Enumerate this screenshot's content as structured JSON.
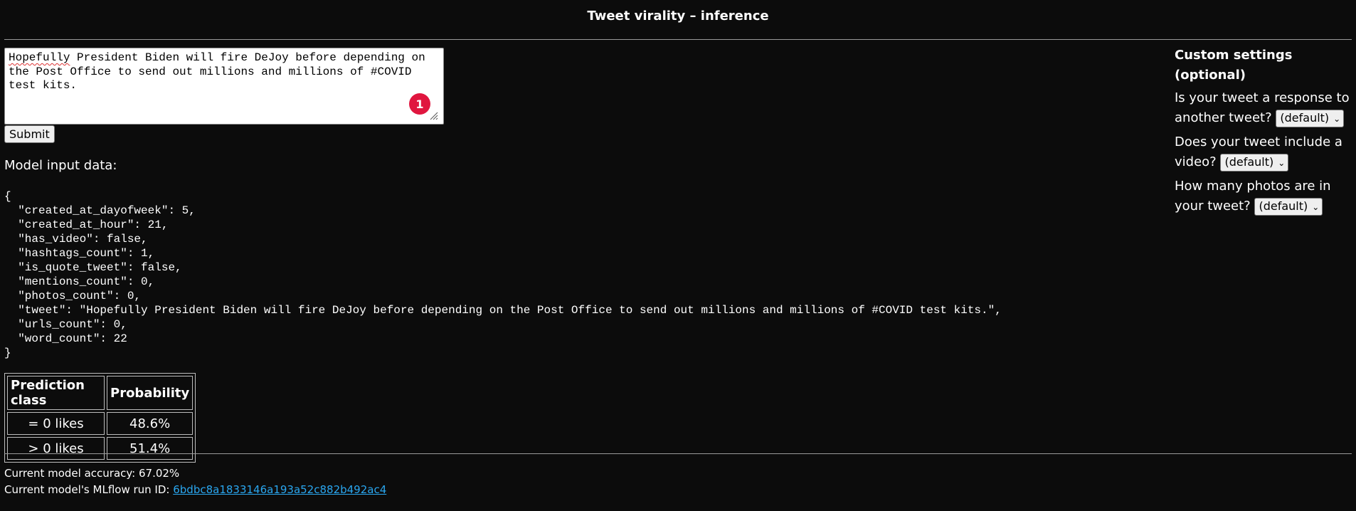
{
  "app": {
    "title": "Tweet virality – inference"
  },
  "tweet_input": {
    "value_part1": "Hopefully",
    "value_part2": " President Biden will fire DeJoy before depending on\nthe Post Office to send out millions and millions of #COVID\ntest kits.",
    "badge": "1"
  },
  "actions": {
    "submit_label": "Submit"
  },
  "model_input": {
    "label": "Model input data:",
    "json_text": "{\n  \"created_at_dayofweek\": 5,\n  \"created_at_hour\": 21,\n  \"has_video\": false,\n  \"hashtags_count\": 1,\n  \"is_quote_tweet\": false,\n  \"mentions_count\": 0,\n  \"photos_count\": 0,\n  \"tweet\": \"Hopefully President Biden will fire DeJoy before depending on the Post Office to send out millions and millions of #COVID test kits.\",\n  \"urls_count\": 0,\n  \"word_count\": 22\n}"
  },
  "prediction_table": {
    "headers": [
      "Prediction class",
      "Probability"
    ],
    "rows": [
      [
        "= 0 likes",
        "48.6%"
      ],
      [
        "> 0 likes",
        "51.4%"
      ]
    ]
  },
  "footer": {
    "accuracy_text": "Current model accuracy: 67.02%",
    "run_id_label": "Current model's MLflow run ID: ",
    "run_id": "6bdbc8a1833146a193a52c882b492ac4"
  },
  "settings": {
    "heading": "Custom settings (optional)",
    "questions": [
      {
        "text": "Is your tweet a response to another tweet?",
        "selected": "(default)"
      },
      {
        "text": "Does your tweet include a video?",
        "selected": "(default)"
      },
      {
        "text": "How many photos are in your tweet?",
        "selected": "(default)"
      }
    ]
  },
  "colors": {
    "background": "#0c0c0c",
    "link": "#2aa7f0",
    "badge": "#e0163f"
  }
}
